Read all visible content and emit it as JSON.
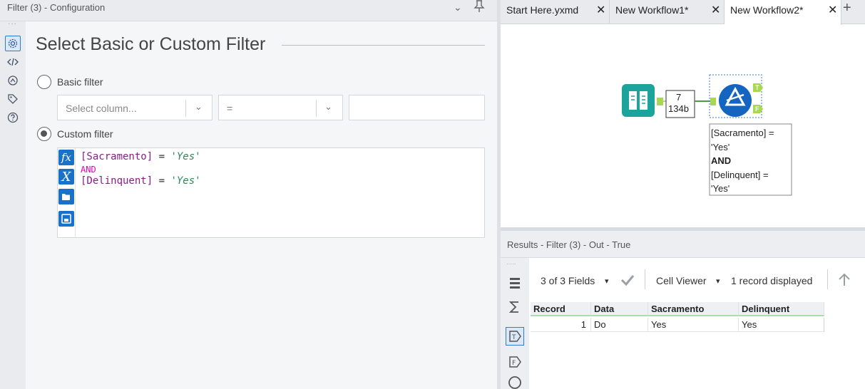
{
  "config": {
    "header_title": "Filter (3) - Configuration",
    "section_title": "Select Basic or Custom Filter",
    "basic_filter_label": "Basic filter",
    "column_placeholder": "Select column...",
    "operator_value": "=",
    "custom_filter_label": "Custom filter",
    "expression": {
      "line1_field": "[Sacramento]",
      "line1_op": " = ",
      "line1_str": "'Yes'",
      "keyword": "AND",
      "line2_field": "[Delinquent]",
      "line2_op": " = ",
      "line2_str": "'Yes'"
    },
    "gutter": {
      "fx": "fx",
      "x": "X"
    }
  },
  "tabs": [
    {
      "label": "Start Here.yxmd"
    },
    {
      "label": "New Workflow1*"
    },
    {
      "label": "New Workflow2*"
    }
  ],
  "canvas": {
    "record_count": "7",
    "record_size": "134b",
    "true_anchor": "T",
    "false_anchor": "F",
    "annotation_lines": [
      "[Sacramento] =",
      "'Yes'",
      "AND",
      "[Delinquent] =",
      "'Yes'"
    ]
  },
  "results": {
    "title": "Results - Filter (3) - Out - True",
    "fields_label": "3 of 3 Fields",
    "viewer_label": "Cell Viewer",
    "records_label": "1 record displayed",
    "columns": [
      "Record",
      "Data",
      "Sacramento",
      "Delinquent"
    ],
    "rows": [
      [
        "1",
        "Do",
        "Yes",
        "Yes"
      ]
    ]
  },
  "colors": {
    "accent": "#1a72c8",
    "anchor_green": "#a7d84d",
    "input_tool": "#1ba39c"
  }
}
